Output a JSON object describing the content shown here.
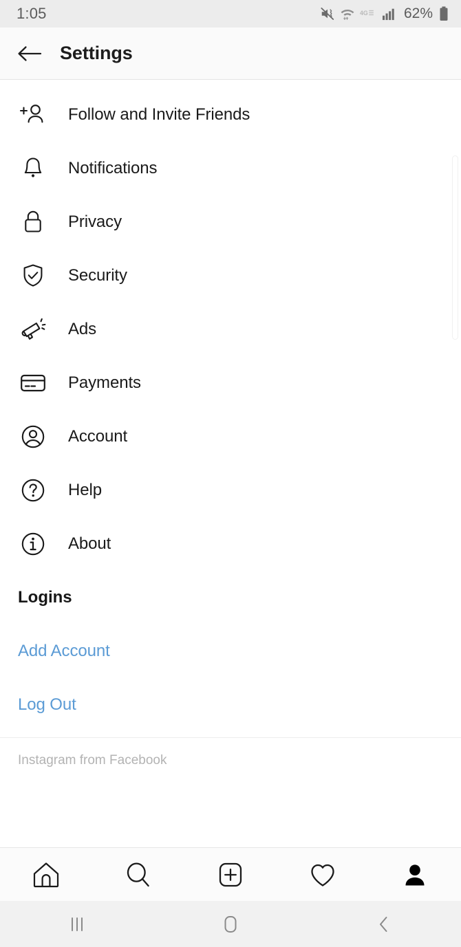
{
  "status_bar": {
    "time": "1:05",
    "battery_percent": "62%",
    "icons": [
      "mute-vibrate-icon",
      "wifi-icon",
      "4g-lte-icon",
      "cellular-signal-icon",
      "battery-icon"
    ],
    "network_label": "4G",
    "background": "#ececec",
    "text_color": "#5b5b5b"
  },
  "app_bar": {
    "back_icon": "back-arrow-icon",
    "title": "Settings",
    "background": "#fafafa"
  },
  "menu": {
    "items": [
      {
        "label": "Follow and Invite Friends",
        "icon": "person-add-icon"
      },
      {
        "label": "Notifications",
        "icon": "bell-icon"
      },
      {
        "label": "Privacy",
        "icon": "lock-icon"
      },
      {
        "label": "Security",
        "icon": "shield-check-icon"
      },
      {
        "label": "Ads",
        "icon": "megaphone-icon"
      },
      {
        "label": "Payments",
        "icon": "credit-card-icon"
      },
      {
        "label": "Account",
        "icon": "account-circle-icon"
      },
      {
        "label": "Help",
        "icon": "question-circle-icon"
      },
      {
        "label": "About",
        "icon": "info-circle-icon"
      }
    ]
  },
  "logins_section": {
    "heading": "Logins",
    "links": [
      {
        "label": "Add Account"
      },
      {
        "label": "Log Out"
      }
    ],
    "link_color": "#5b9bd5"
  },
  "footer": {
    "note": "Instagram from Facebook",
    "note_color": "#b3b3b3"
  },
  "tab_bar": {
    "tabs": [
      {
        "name": "home",
        "icon": "home-icon",
        "active": false
      },
      {
        "name": "search",
        "icon": "search-icon",
        "active": false
      },
      {
        "name": "create",
        "icon": "plus-square-icon",
        "active": false
      },
      {
        "name": "activity",
        "icon": "heart-icon",
        "active": false
      },
      {
        "name": "profile",
        "icon": "person-filled-icon",
        "active": true
      }
    ]
  },
  "system_nav": {
    "buttons": [
      {
        "name": "recents",
        "icon": "recents-bars-icon"
      },
      {
        "name": "home",
        "icon": "home-square-icon"
      },
      {
        "name": "back",
        "icon": "back-chevron-icon"
      }
    ],
    "background": "#f1f1f1",
    "icon_color": "#8a8a8a"
  }
}
